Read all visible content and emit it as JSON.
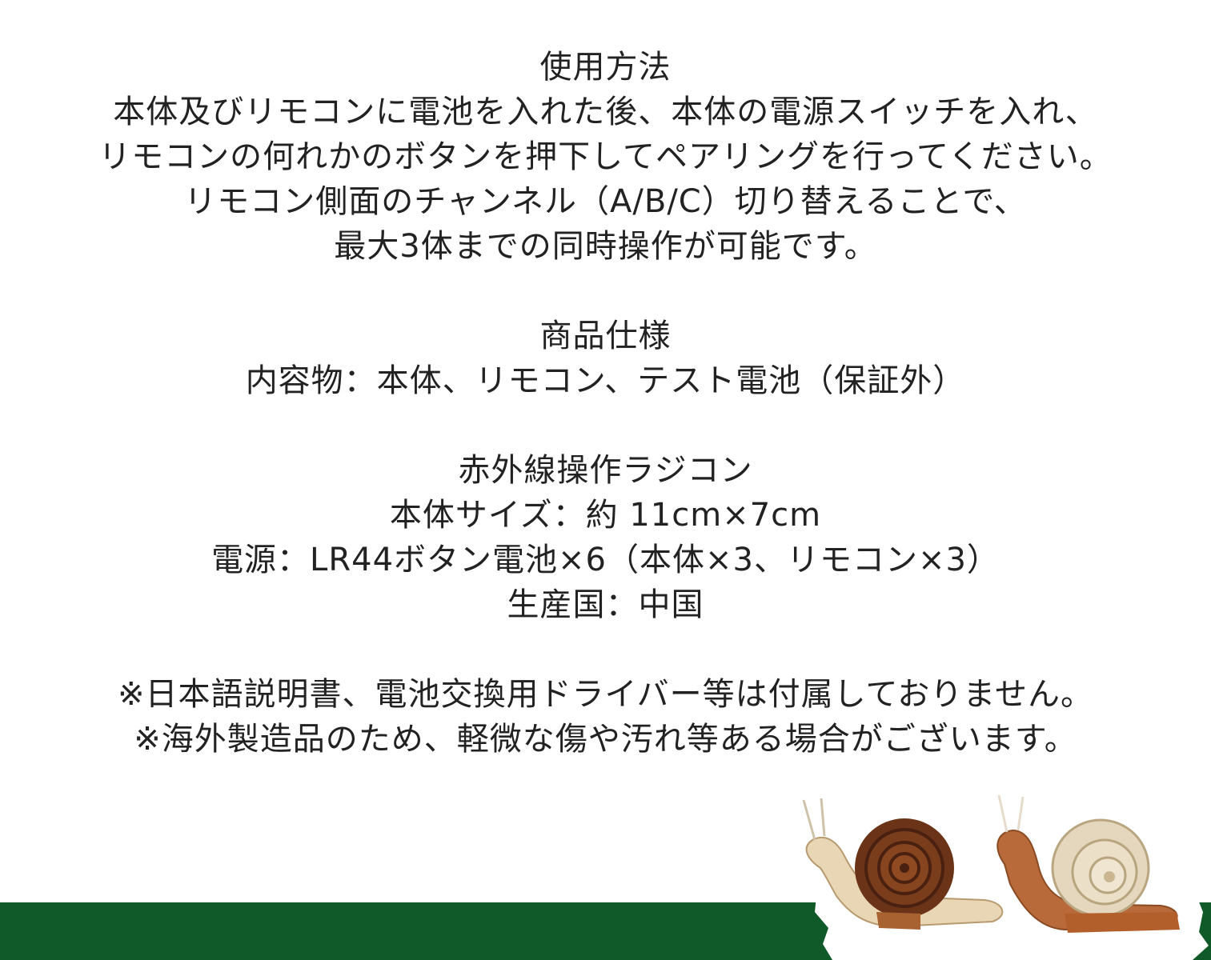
{
  "usage": {
    "heading": "使用方法",
    "lines": [
      "本体及びリモコンに電池を入れた後、本体の電源スイッチを入れ、",
      "リモコンの何れかのボタンを押下してペアリングを行ってください。",
      "リモコン側面のチャンネル（A/B/C）切り替えることで、",
      "最大3体までの同時操作が可能です。"
    ]
  },
  "specs": {
    "heading": "商品仕様",
    "contents": "内容物：本体、リモコン、テスト電池（保証外）",
    "type": "赤外線操作ラジコン",
    "size": "本体サイズ：約 11cm×7cm",
    "power": "電源：LR44ボタン電池×6（本体×3、リモコン×3）",
    "origin": "生産国：中国"
  },
  "notes": [
    "※日本語説明書、電池交換用ドライバー等は付属しておりません。",
    "※海外製造品のため、軽微な傷や汚れ等ある場合がございます。"
  ],
  "colors": {
    "band": "#0f5a28",
    "text": "#222222"
  },
  "illustration": "two toy snails (dark brown shell and cream shell) on a white torn-paper patch"
}
